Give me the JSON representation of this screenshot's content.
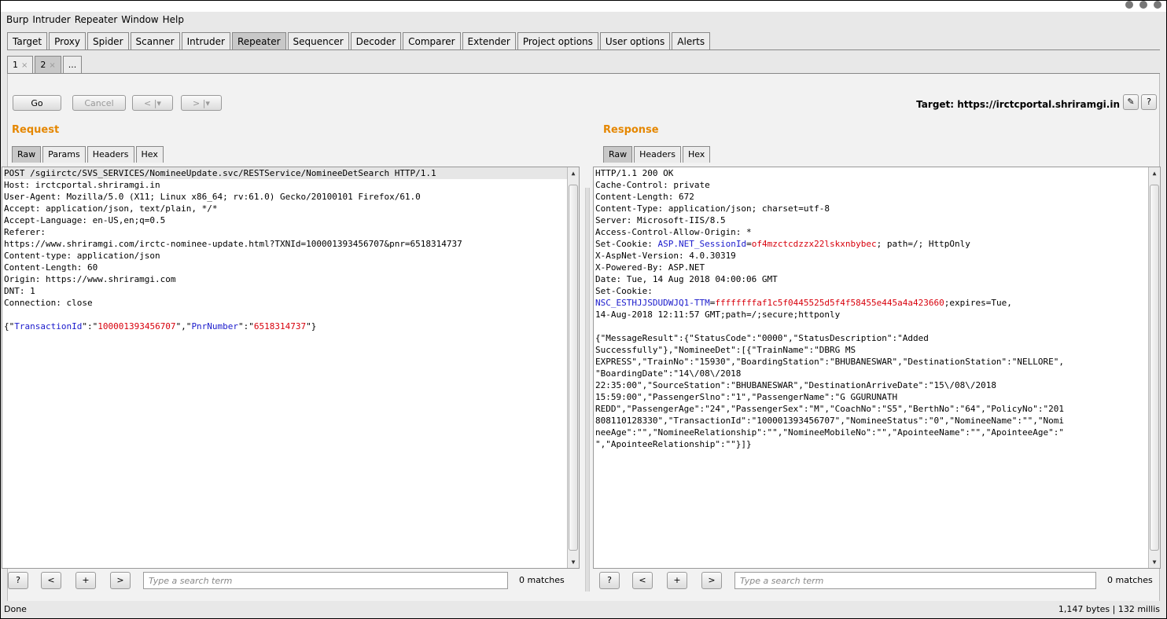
{
  "menu": [
    "Burp",
    "Intruder",
    "Repeater",
    "Window",
    "Help"
  ],
  "tabs": [
    {
      "label": "Target",
      "active": false
    },
    {
      "label": "Proxy",
      "active": false
    },
    {
      "label": "Spider",
      "active": false
    },
    {
      "label": "Scanner",
      "active": false
    },
    {
      "label": "Intruder",
      "active": false
    },
    {
      "label": "Repeater",
      "active": true
    },
    {
      "label": "Sequencer",
      "active": false
    },
    {
      "label": "Decoder",
      "active": false
    },
    {
      "label": "Comparer",
      "active": false
    },
    {
      "label": "Extender",
      "active": false
    },
    {
      "label": "Project options",
      "active": false
    },
    {
      "label": "User options",
      "active": false
    },
    {
      "label": "Alerts",
      "active": false
    }
  ],
  "subtabs": [
    {
      "label": "1",
      "close": "×",
      "active": false
    },
    {
      "label": "2",
      "close": "×",
      "active": true
    },
    {
      "label": "...",
      "close": "",
      "active": false
    }
  ],
  "toolbar": {
    "go": "Go",
    "cancel": "Cancel",
    "back": "< |▾",
    "forward": "> |▾",
    "target": "Target: https://irctcportal.shriramgi.in",
    "edit_icon": "✎",
    "help_icon": "?"
  },
  "request": {
    "title": "Request",
    "tabs": [
      "Raw",
      "Params",
      "Headers",
      "Hex"
    ],
    "lines": [
      "POST /sgiirctc/SVS_SERVICES/NomineeUpdate.svc/RESTService/NomineeDetSearch HTTP/1.1",
      "Host: irctcportal.shriramgi.in",
      "User-Agent: Mozilla/5.0 (X11; Linux x86_64; rv:61.0) Gecko/20100101 Firefox/61.0",
      "Accept: application/json, text/plain, */*",
      "Accept-Language: en-US,en;q=0.5",
      "Referer:",
      "https://www.shriramgi.com/irctc-nominee-update.html?TXNId=100001393456707&pnr=6518314737",
      "Content-type: application/json",
      "Content-Length: 60",
      "Origin: https://www.shriramgi.com",
      "DNT: 1",
      "Connection: close",
      ""
    ],
    "body": {
      "open": "{\"",
      "k1": "TransactionId",
      "sep1": "\":\"",
      "v1": "100001393456707",
      "sep2": "\",\"",
      "k2": "PnrNumber",
      "sep3": "\":\"",
      "v2": "6518314737",
      "close": "\"}"
    },
    "search_placeholder": "Type a search term",
    "matches": "0 matches"
  },
  "response": {
    "title": "Response",
    "tabs": [
      "Raw",
      "Headers",
      "Hex"
    ],
    "lines_a": [
      "HTTP/1.1 200 OK",
      "Cache-Control: private",
      "Content-Length: 672",
      "Content-Type: application/json; charset=utf-8",
      "Server: Microsoft-IIS/8.5",
      "Access-Control-Allow-Origin: *"
    ],
    "cookie1": {
      "prefix": "Set-Cookie: ",
      "name": "ASP.NET_SessionId",
      "eq": "=",
      "value": "of4mzctcdzzx22lskxnbybec",
      "rest": "; path=/; HttpOnly"
    },
    "lines_b": [
      "X-AspNet-Version: 4.0.30319",
      "X-Powered-By: ASP.NET",
      "Date: Tue, 14 Aug 2018 04:00:06 GMT",
      "Set-Cookie:"
    ],
    "cookie2": {
      "name": "NSC_ESTHJJSDUDWJQ1-TTM",
      "eq": "=",
      "value": "ffffffffaf1c5f0445525d5f4f58455e445a4a423660",
      "rest": ";expires=Tue,"
    },
    "lines_c": [
      "14-Aug-2018 12:11:57 GMT;path=/;secure;httponly",
      "",
      "{\"MessageResult\":{\"StatusCode\":\"0000\",\"StatusDescription\":\"Added",
      "Successfully\"},\"NomineeDet\":[{\"TrainName\":\"DBRG MS",
      "EXPRESS\",\"TrainNo\":\"15930\",\"BoardingStation\":\"BHUBANESWAR\",\"DestinationStation\":\"NELLORE\",",
      "\"BoardingDate\":\"14\\/08\\/2018",
      "22:35:00\",\"SourceStation\":\"BHUBANESWAR\",\"DestinationArriveDate\":\"15\\/08\\/2018",
      "15:59:00\",\"PassengerSlno\":\"1\",\"PassengerName\":\"G GGURUNATH",
      "REDD\",\"PassengerAge\":\"24\",\"PassengerSex\":\"M\",\"CoachNo\":\"S5\",\"BerthNo\":\"64\",\"PolicyNo\":\"201",
      "808110128330\",\"TransactionId\":\"100001393456707\",\"NomineeStatus\":\"0\",\"NomineeName\":\"\",\"Nomi",
      "neeAge\":\"\",\"NomineeRelationship\":\"\",\"NomineeMobileNo\":\"\",\"ApointeeName\":\"\",\"ApointeeAge\":\"",
      "\",\"ApointeeRelationship\":\"\"}]}"
    ],
    "search_placeholder": "Type a search term",
    "matches": "0 matches"
  },
  "search_buttons": [
    "?",
    "<",
    "+",
    ">"
  ],
  "status": {
    "left": "Done",
    "right": "1,147 bytes | 132 millis"
  }
}
